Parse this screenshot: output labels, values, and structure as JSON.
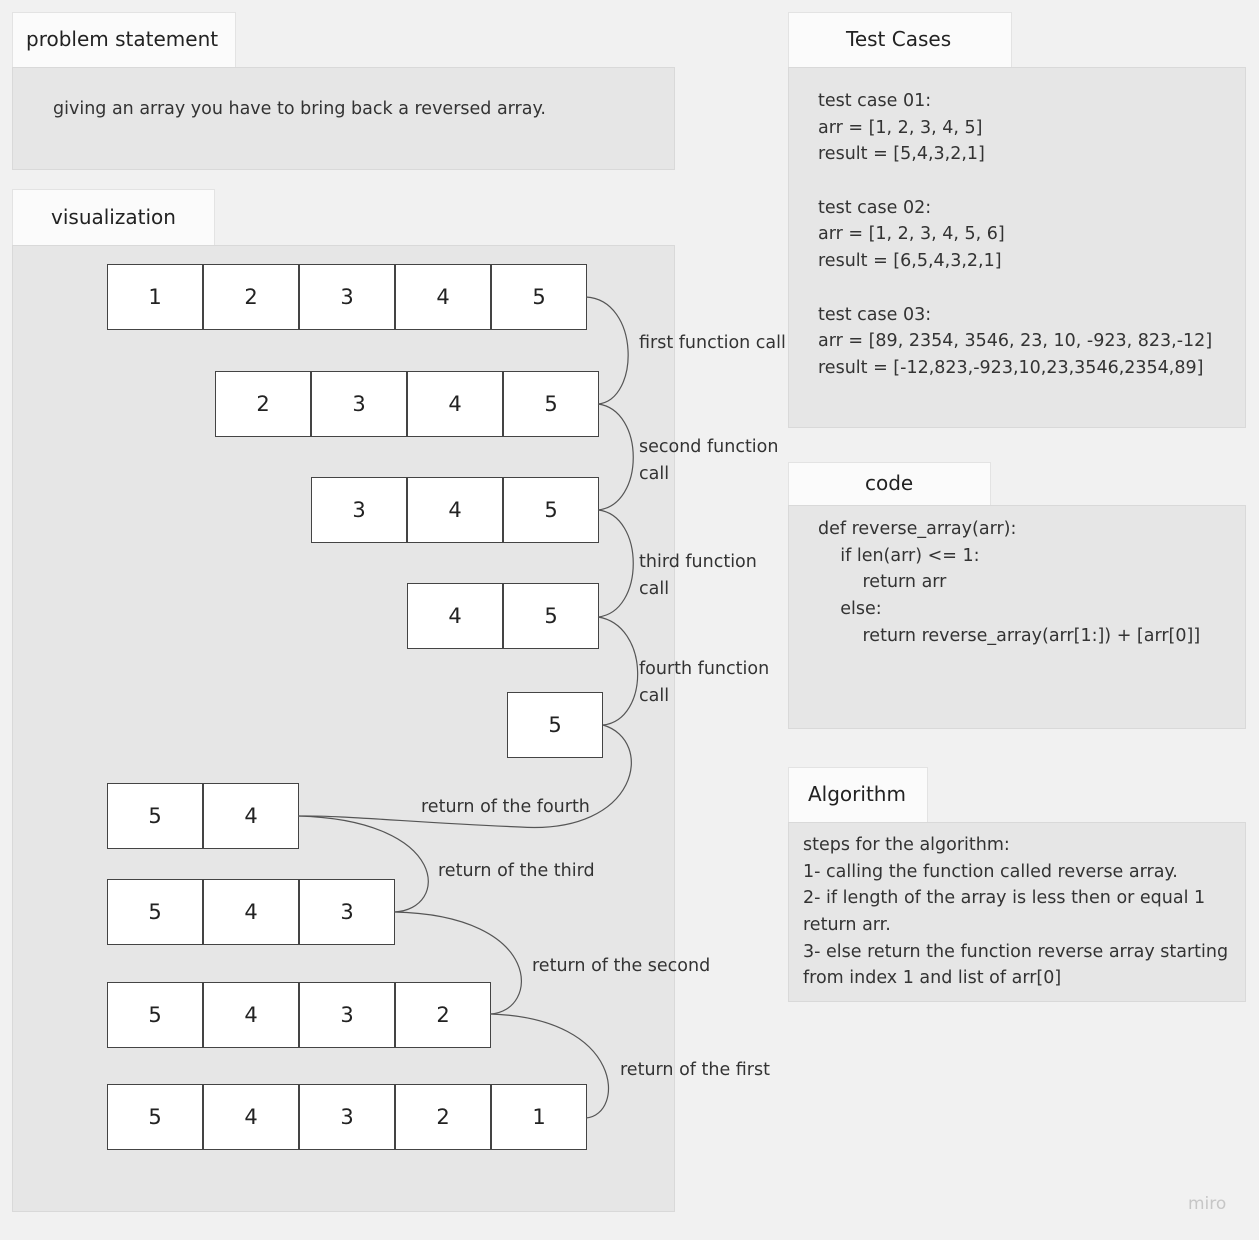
{
  "problem": {
    "title": "problem statement",
    "text": "giving an array you have to bring back a reversed array."
  },
  "visualization": {
    "title": "visualization",
    "rows": [
      {
        "values": [
          "1",
          "2",
          "3",
          "4",
          "5"
        ]
      },
      {
        "values": [
          "2",
          "3",
          "4",
          "5"
        ]
      },
      {
        "values": [
          "3",
          "4",
          "5"
        ]
      },
      {
        "values": [
          "4",
          "5"
        ]
      },
      {
        "values": [
          "5"
        ]
      },
      {
        "values": [
          "5",
          "4"
        ]
      },
      {
        "values": [
          "5",
          "4",
          "3"
        ]
      },
      {
        "values": [
          "5",
          "4",
          "3",
          "2"
        ]
      },
      {
        "values": [
          "5",
          "4",
          "3",
          "2",
          "1"
        ]
      }
    ],
    "labels": {
      "first_call": "first function call",
      "second_call": "second function\ncall",
      "third_call": "third function\ncall",
      "fourth_call": "fourth function\ncall",
      "return_fourth": "return of the fourth",
      "return_third": "return of the third",
      "return_second": "return of the second",
      "return_first": "return of the first"
    }
  },
  "test_cases": {
    "title": "Test Cases",
    "lines": [
      "test case 01:",
      "arr = [1, 2, 3, 4, 5]",
      "result = [5,4,3,2,1]",
      "",
      "test case 02:",
      "arr = [1, 2, 3, 4, 5, 6]",
      "result = [6,5,4,3,2,1]",
      "",
      "test case 03:",
      "arr = [89, 2354, 3546, 23, 10, -923, 823,-12]",
      "result = [-12,823,-923,10,23,3546,2354,89]"
    ]
  },
  "code": {
    "title": "code",
    "lines": [
      "def reverse_array(arr):",
      "    if len(arr) <= 1:",
      "        return arr",
      "    else:",
      "        return reverse_array(arr[1:]) + [arr[0]]"
    ]
  },
  "algorithm": {
    "title": "Algorithm",
    "lines": [
      "steps for the algorithm:",
      "1- calling the function called reverse array.",
      "2- if length of the array is less then or equal 1",
      "return arr.",
      "3- else return the function reverse array starting",
      "from index 1 and list of arr[0]"
    ]
  },
  "watermark": "miro",
  "colors": {
    "background": "#f1f1f1",
    "panel": "#e6e6e6",
    "tab": "#fbfbfb",
    "cell": "#ffffff",
    "line": "#444444"
  }
}
